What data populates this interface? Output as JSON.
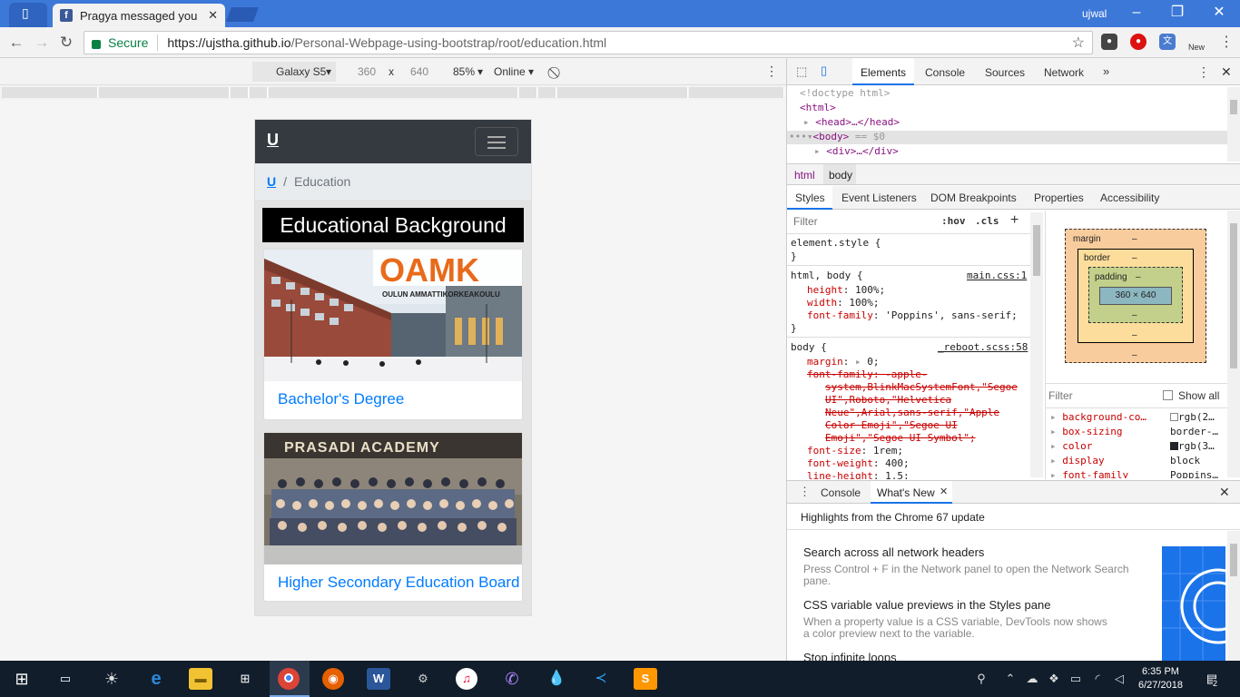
{
  "browser": {
    "tab_title": "Pragya messaged you",
    "user": "ujwal",
    "secure_label": "Secure",
    "url_host": "https://ujstha.github.io",
    "url_path": "/Personal-Webpage-using-bootstrap/root/education.html",
    "ext_new_label": "New"
  },
  "device_toolbar": {
    "device": "Galaxy S5",
    "width": "360",
    "times": "x",
    "height": "640",
    "zoom": "85%",
    "network": "Online"
  },
  "page": {
    "brand": "U",
    "breadcrumb_home": "U",
    "breadcrumb_sep": "/",
    "breadcrumb_current": "Education",
    "heading": "Educational Background",
    "cards": [
      {
        "title": "Bachelor's Degree",
        "image_text": "OAMK",
        "image_subtext": "OULUN AMMATTIKORKEAKOULU"
      },
      {
        "title": "Higher Secondary Education Board",
        "image_text": "PRASADI ACADEMY"
      }
    ]
  },
  "devtools": {
    "tabs": [
      "Elements",
      "Console",
      "Sources",
      "Network"
    ],
    "dom": {
      "doctype": "<!doctype html>",
      "html_open": "<html>",
      "head": "<head>…</head>",
      "body": "<body>",
      "body_eq": "== $0",
      "div": "<div>…</div>"
    },
    "crumbs": [
      "html",
      "body"
    ],
    "sub_tabs": [
      "Styles",
      "Event Listeners",
      "DOM Breakpoints",
      "Properties",
      "Accessibility"
    ],
    "filter_placeholder": "Filter",
    "hov": ":hov",
    "cls": ".cls",
    "styles": {
      "element_style": "element.style {",
      "close": "}",
      "rule1_selector": "html, body {",
      "rule1_source": "main.css:1",
      "rule1_props": [
        {
          "name": "height",
          "value": "100%;"
        },
        {
          "name": "width",
          "value": "100%;"
        },
        {
          "name": "font-family",
          "value": "'Poppins', sans-serif;"
        }
      ],
      "rule2_selector": "body {",
      "rule2_source": "_reboot.scss:58",
      "margin": "margin",
      "margin_val": "0;",
      "font_family_struck": "font-family: -apple-",
      "struck_lines": [
        "system,BlinkMacSystemFont,\"Segoe",
        "UI\",Roboto,\"Helvetica",
        "Neue\",Arial,sans-serif,\"Apple",
        "Color Emoji\",\"Segoe UI",
        "Emoji\",\"Segoe UI Symbol\";"
      ],
      "rule2_props": [
        {
          "name": "font-size",
          "value": "1rem;"
        },
        {
          "name": "font-weight",
          "value": "400;"
        },
        {
          "name": "line-height",
          "value": "1.5;"
        }
      ]
    },
    "box_model": {
      "margin": "margin",
      "border": "border",
      "padding": "padding",
      "dash": "–",
      "content": "360 × 640"
    },
    "computed": {
      "filter_placeholder": "Filter",
      "show_all": "Show all",
      "rows": [
        {
          "name": "background-co…",
          "value": "rgb(2…",
          "swatch": "#ffffff"
        },
        {
          "name": "box-sizing",
          "value": "border-…",
          "swatch": ""
        },
        {
          "name": "color",
          "value": "rgb(3…",
          "swatch": "#212529"
        },
        {
          "name": "display",
          "value": "block",
          "swatch": ""
        },
        {
          "name": "font-family",
          "value": "Poppins…",
          "swatch": ""
        }
      ]
    },
    "drawer": {
      "tabs": [
        "Console",
        "What's New"
      ],
      "highlights": "Highlights from the Chrome 67 update",
      "items": [
        {
          "title": "Search across all network headers",
          "desc": "Press Control + F in the Network panel to open the Network Search pane."
        },
        {
          "title": "CSS variable value previews in the Styles pane",
          "desc": "When a property value is a CSS variable, DevTools now shows a color preview next to the variable."
        },
        {
          "title": "Stop infinite loops",
          "desc": ""
        }
      ]
    }
  },
  "taskbar": {
    "time": "6:35 PM",
    "date": "6/27/2018",
    "notifications": "2"
  },
  "colors": {
    "chrome_blue": "#3c78d8",
    "bootstrap_dark": "#343a40",
    "link_blue": "#007bff",
    "taskbar": "#111d2b"
  }
}
